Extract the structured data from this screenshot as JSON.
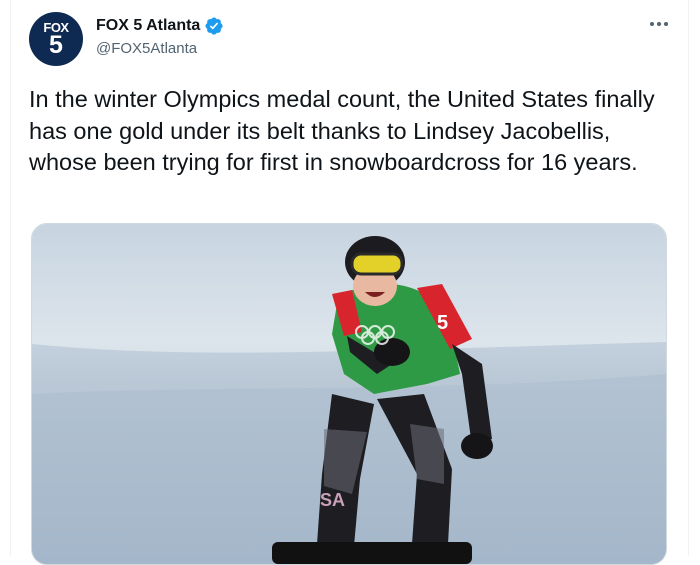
{
  "account": {
    "display_name": "FOX 5 Atlanta",
    "handle": "@FOX5Atlanta",
    "avatar_text_top": "FOX",
    "avatar_text_bottom": "5"
  },
  "tweet": {
    "text": "In the winter Olympics medal count, the United States finally has one gold under its belt thanks to Lindsey Jacobellis, whose been trying for first in snowboardcross for 16 years."
  },
  "photo": {
    "bib_number": "5",
    "leg_text": "SA"
  },
  "colors": {
    "verified_badge": "#1d9bf0",
    "avatar_bg": "#0f2a52",
    "text_primary": "#0f1419",
    "text_secondary": "#536471"
  },
  "icons": [
    "verified-icon",
    "more-icon"
  ]
}
